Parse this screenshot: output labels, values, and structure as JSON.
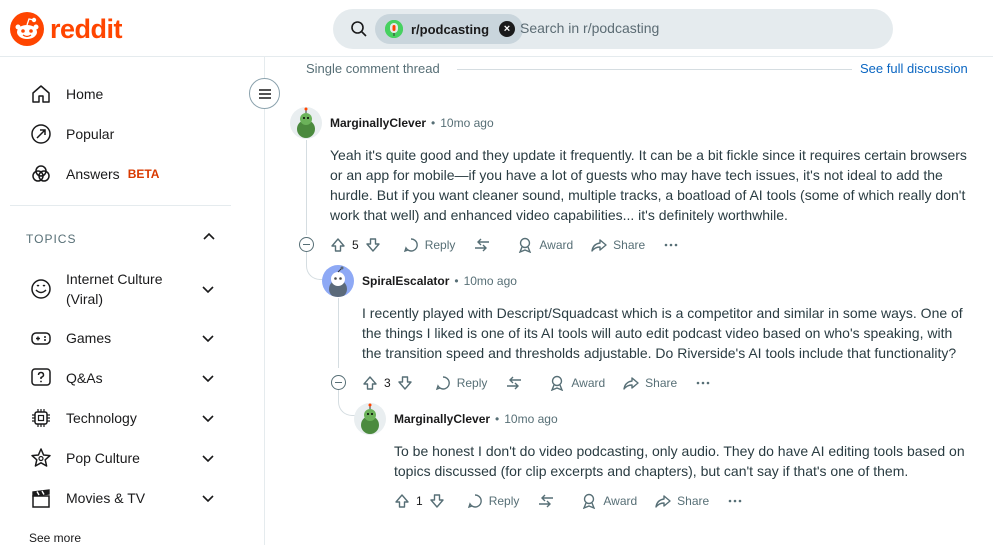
{
  "header": {
    "logo_text": "reddit",
    "search_chip": "r/podcasting",
    "search_placeholder": "Search in r/podcasting",
    "brand_color": "#ff4500"
  },
  "sidebar": {
    "nav": [
      {
        "label": "Home",
        "icon": "home-icon"
      },
      {
        "label": "Popular",
        "icon": "popular-icon"
      },
      {
        "label": "Answers",
        "badge": "BETA",
        "icon": "answers-icon"
      }
    ],
    "topics_header": "TOPICS",
    "topics": [
      {
        "label": "Internet Culture\n(Viral)",
        "icon": "smile-icon"
      },
      {
        "label": "Games",
        "icon": "gamepad-icon"
      },
      {
        "label": "Q&As",
        "icon": "question-icon"
      },
      {
        "label": "Technology",
        "icon": "chip-icon"
      },
      {
        "label": "Pop Culture",
        "icon": "star-icon"
      },
      {
        "label": "Movies & TV",
        "icon": "clapper-icon"
      }
    ],
    "see_more": "See more"
  },
  "thread": {
    "header": "Single comment thread",
    "see_full": "See full discussion",
    "comments": [
      {
        "author": "MarginallyClever",
        "time": "10mo ago",
        "body": "Yeah it's quite good and they update it frequently. It can be a bit fickle since it requires certain browsers or an app for mobile—if you have a lot of guests who may have tech issues, it's not ideal to add the hurdle. But if you want cleaner sound, multiple tracks, a boatload of AI tools (some of which really don't work that well) and enhanced video capabilities... it's definitely worthwhile.",
        "votes": "5",
        "reply": "Reply",
        "award": "Award",
        "share": "Share"
      },
      {
        "author": "SpiralEscalator",
        "time": "10mo ago",
        "body": "I recently played with Descript/Squadcast which is a competitor and similar in some ways. One of the things I liked is one of its AI tools will auto edit podcast video based on who's speaking, with the transition speed and thresholds adjustable. Do Riverside's AI tools include that functionality?",
        "votes": "3",
        "reply": "Reply",
        "award": "Award",
        "share": "Share"
      },
      {
        "author": "MarginallyClever",
        "time": "10mo ago",
        "body": "To be honest I don't do video podcasting, only audio. They do have AI editing tools based on topics discussed (for clip excerpts and chapters), but can't say if that's one of them.",
        "votes": "1",
        "reply": "Reply",
        "award": "Award",
        "share": "Share"
      }
    ]
  }
}
